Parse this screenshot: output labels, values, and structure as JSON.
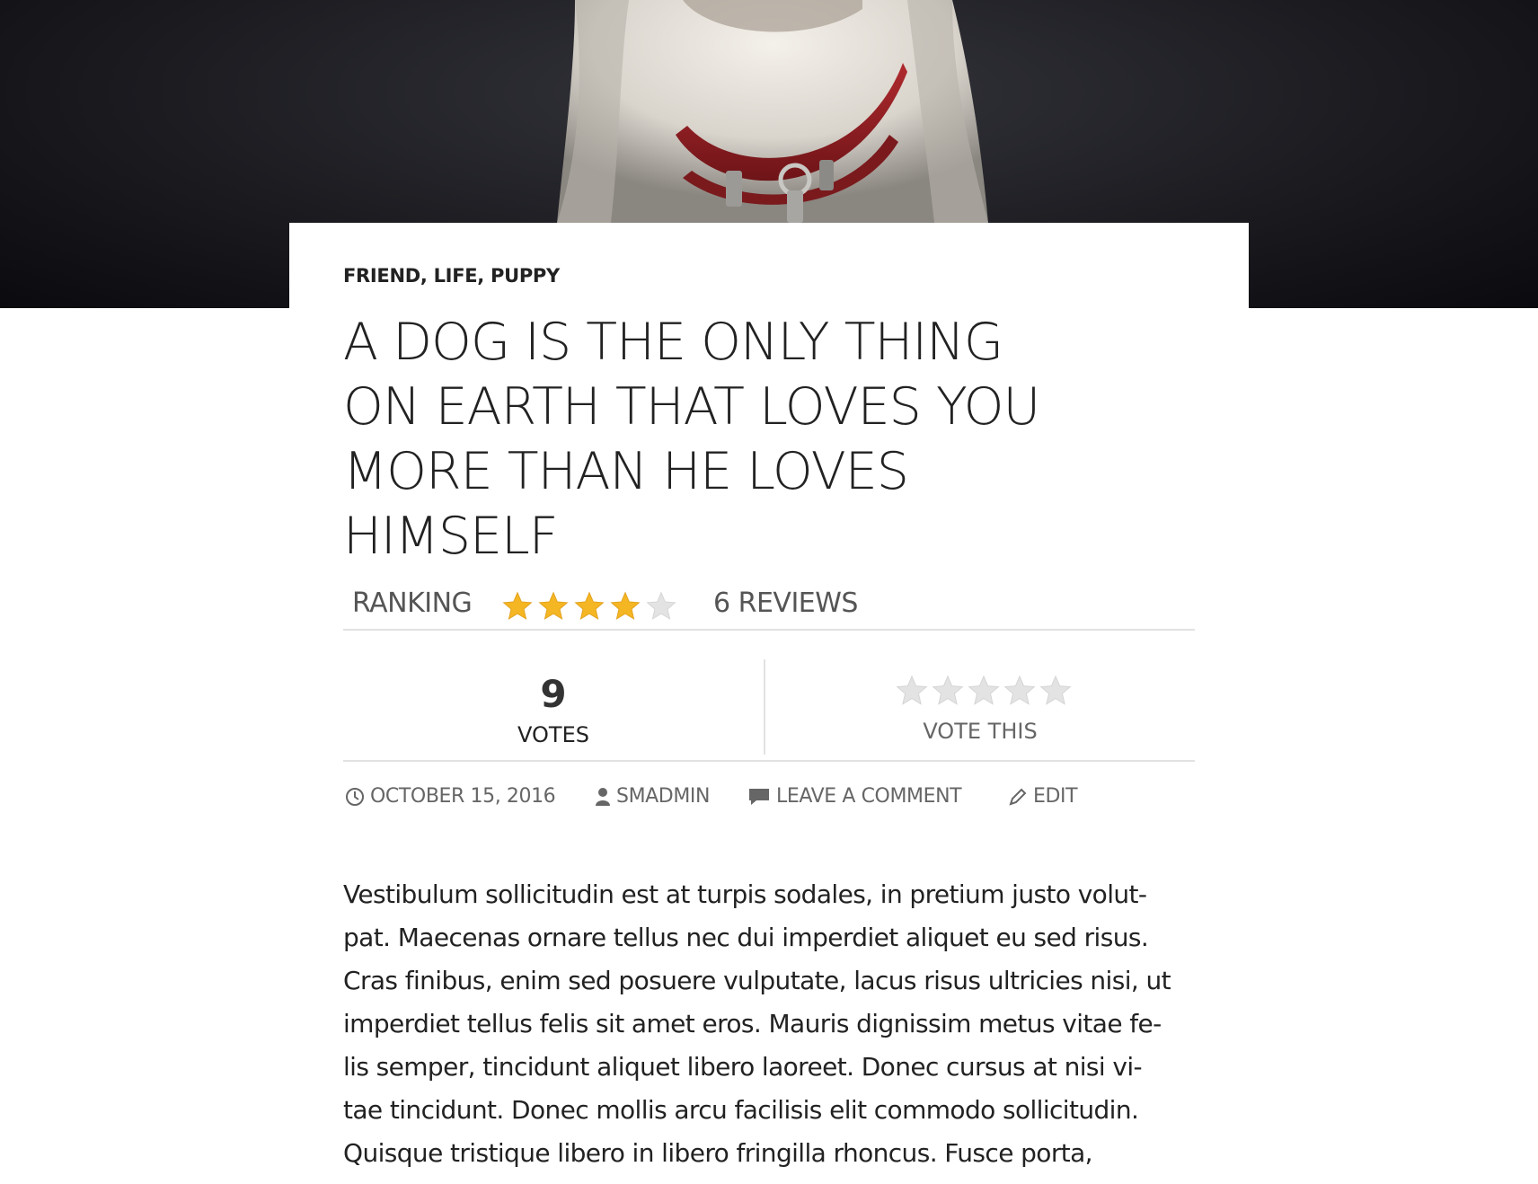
{
  "hero": {
    "image": "dog-with-red-collar-photo"
  },
  "post": {
    "categories": [
      "FRIEND",
      "LIFE",
      "PUPPY"
    ],
    "title_lines": [
      "A DOG IS THE ONLY THING",
      "ON EARTH THAT LOVES YOU",
      "MORE THAN HE LOVES",
      "HIMSELF"
    ]
  },
  "ranking": {
    "label": "RANKING",
    "rating": 4,
    "max": 5,
    "reviews": "6 REVIEWS"
  },
  "votes": {
    "count": "9",
    "label": "VOTES",
    "vote_this": "VOTE THIS"
  },
  "meta": {
    "date": "OCTOBER 15, 2016",
    "author": "SMADMIN",
    "comment": "LEAVE A COMMENT",
    "edit": "EDIT"
  },
  "body": {
    "lines": [
      "Vestibulum sollicitudin est at turpis sodales, in pretium justo volut-",
      "pat. Maecenas ornare tellus nec dui imperdiet aliquet eu sed risus.",
      "Cras finibus, enim sed posuere vulputate, lacus risus ultricies nisi, ut",
      "imperdiet tellus felis sit amet eros. Mauris dignissim metus vitae fe-",
      "lis semper, tincidunt aliquet libero laoreet. Donec cursus at nisi vi-",
      "tae tincidunt. Donec mollis arcu facilisis elit commodo sollicitudin.",
      "Quisque tristique libero in libero fringilla rhoncus. Fusce porta,"
    ]
  },
  "colors": {
    "star_filled": "#f5b623",
    "star_empty": "#e3e3e3",
    "text": "#222222",
    "muted": "#666666",
    "divider": "#e2e2e2",
    "collar": "#8e1c21"
  }
}
